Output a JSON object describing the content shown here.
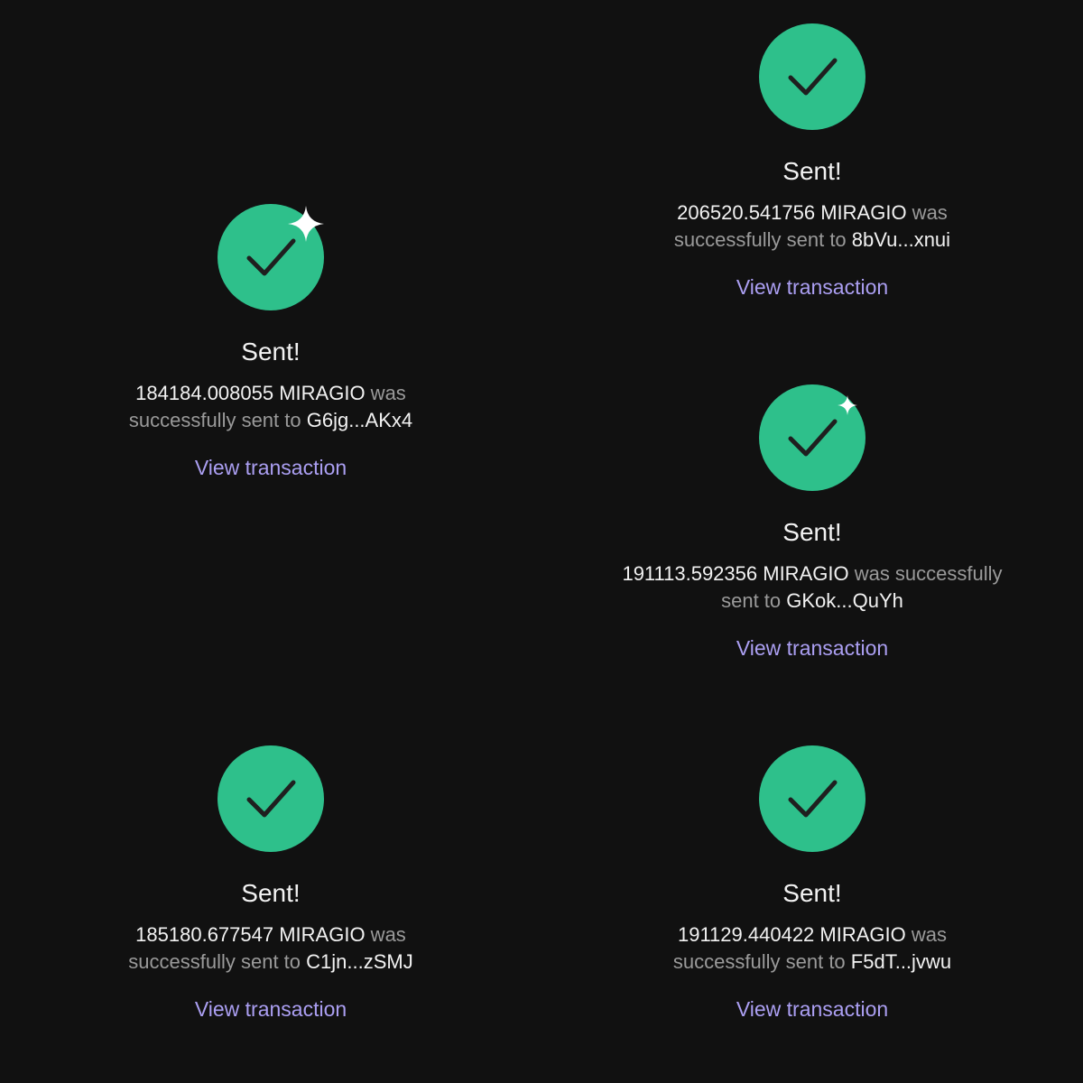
{
  "colors": {
    "background": "#111111",
    "success_circle": "#2ec08b",
    "checkmark": "#1f1f1f",
    "title_text": "#f2f2f2",
    "secondary_text": "#9a9a9a",
    "link": "#ab9ff2"
  },
  "icons": {
    "status": "checkmark-icon",
    "accent": "sparkle-icon"
  },
  "cards": [
    {
      "title": "Sent!",
      "amount": "184184.008055 MIRAGIO",
      "line1_suffix": " was",
      "line2_prefix": "successfully sent to ",
      "recipient": "G6jg...AKx4",
      "link_label": "View transaction",
      "has_sparkle": true
    },
    {
      "title": "Sent!",
      "amount": "206520.541756 MIRAGIO",
      "line1_suffix": " was",
      "line2_prefix": "successfully sent to ",
      "recipient": "8bVu...xnui",
      "link_label": "View transaction",
      "has_sparkle": false
    },
    {
      "title": "Sent!",
      "amount": "191113.592356 MIRAGIO",
      "line1_suffix": " was successfully",
      "line2_prefix": "sent to ",
      "recipient": "GKok...QuYh",
      "link_label": "View transaction",
      "has_sparkle": true
    },
    {
      "title": "Sent!",
      "amount": "185180.677547 MIRAGIO",
      "line1_suffix": " was",
      "line2_prefix": "successfully sent to ",
      "recipient": "C1jn...zSMJ",
      "link_label": "View transaction",
      "has_sparkle": false
    },
    {
      "title": "Sent!",
      "amount": "191129.440422 MIRAGIO",
      "line1_suffix": " was",
      "line2_prefix": "successfully sent to ",
      "recipient": "F5dT...jvwu",
      "link_label": "View transaction",
      "has_sparkle": false
    }
  ]
}
